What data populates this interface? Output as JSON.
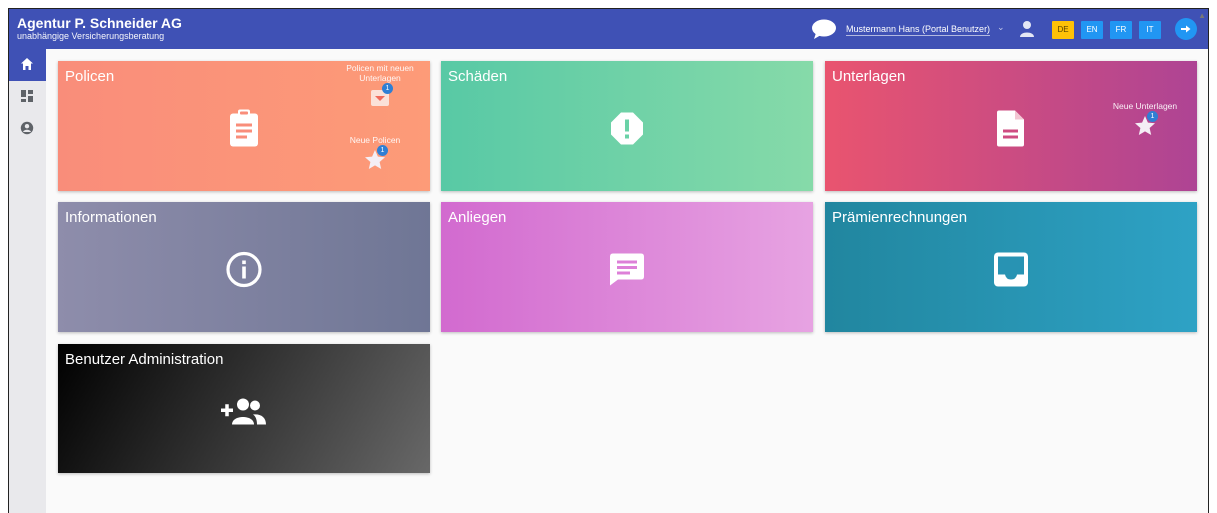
{
  "header": {
    "company_name": "Agentur P. Schneider AG",
    "company_tagline": "unabhängige Versicherungsberatung",
    "user_name": "Mustermann Hans (Portal Benutzer)",
    "languages": [
      "DE",
      "EN",
      "FR",
      "IT"
    ],
    "active_language": "DE"
  },
  "sidebar": {
    "items": [
      {
        "icon": "home-icon",
        "active": true
      },
      {
        "icon": "dashboard-icon",
        "active": false
      },
      {
        "icon": "account-circle-icon",
        "active": false
      }
    ]
  },
  "tiles": {
    "policen": {
      "title": "Policen",
      "badges": [
        {
          "label": "Policen mit neuen Unterlagen",
          "count": "1",
          "icon": "mail-icon"
        },
        {
          "label": "Neue Policen",
          "count": "1",
          "icon": "star-icon"
        }
      ]
    },
    "schaeden": {
      "title": "Schäden"
    },
    "unterlagen": {
      "title": "Unterlagen",
      "badges": [
        {
          "label": "Neue Unterlagen",
          "count": "1",
          "icon": "star-icon"
        }
      ]
    },
    "informationen": {
      "title": "Informationen"
    },
    "anliegen": {
      "title": "Anliegen"
    },
    "praemienrechnungen": {
      "title": "Prämienrechnungen"
    },
    "benutzer_administration": {
      "title": "Benutzer Administration"
    }
  },
  "colors": {
    "header": "#3f51b5",
    "accent_blue": "#2196f3",
    "active_language": "#ffc107"
  }
}
